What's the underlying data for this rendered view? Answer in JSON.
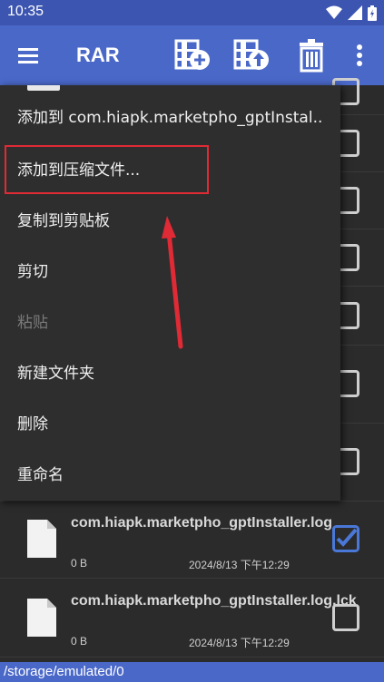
{
  "status_bar": {
    "time": "10:35",
    "icons": [
      "wifi-icon",
      "signal-icon",
      "battery-icon"
    ]
  },
  "app_bar": {
    "title": "RAR",
    "actions": [
      "archive-add-icon",
      "archive-extract-icon",
      "trash-icon",
      "more-vert-icon"
    ]
  },
  "context_menu": {
    "items": [
      {
        "label": "添加到 com.hiapk.marketpho_gptInstal..",
        "enabled": true
      },
      {
        "label": "添加到压缩文件...",
        "enabled": true
      },
      {
        "label": "复制到剪贴板",
        "enabled": true
      },
      {
        "label": "剪切",
        "enabled": true
      },
      {
        "label": "粘贴",
        "enabled": false
      },
      {
        "label": "新建文件夹",
        "enabled": true
      },
      {
        "label": "删除",
        "enabled": true
      },
      {
        "label": "重命名",
        "enabled": true
      }
    ]
  },
  "files": [
    {
      "name": "com.hiapk.marketpho_gptInstaller.log",
      "size": "0 B",
      "date": "2024/8/13 下午12:29",
      "checked": true
    },
    {
      "name": "com.hiapk.marketpho_gptInstaller.log.lck",
      "size": "0 B",
      "date": "2024/8/13 下午12:29",
      "checked": false
    }
  ],
  "path_bar": {
    "path": "/storage/emulated/0"
  },
  "colors": {
    "app_bar": "#4a68c8",
    "status_bar": "#3c55b0",
    "highlight": "#e02a35",
    "checkbox_checked": "#4a78d8"
  }
}
